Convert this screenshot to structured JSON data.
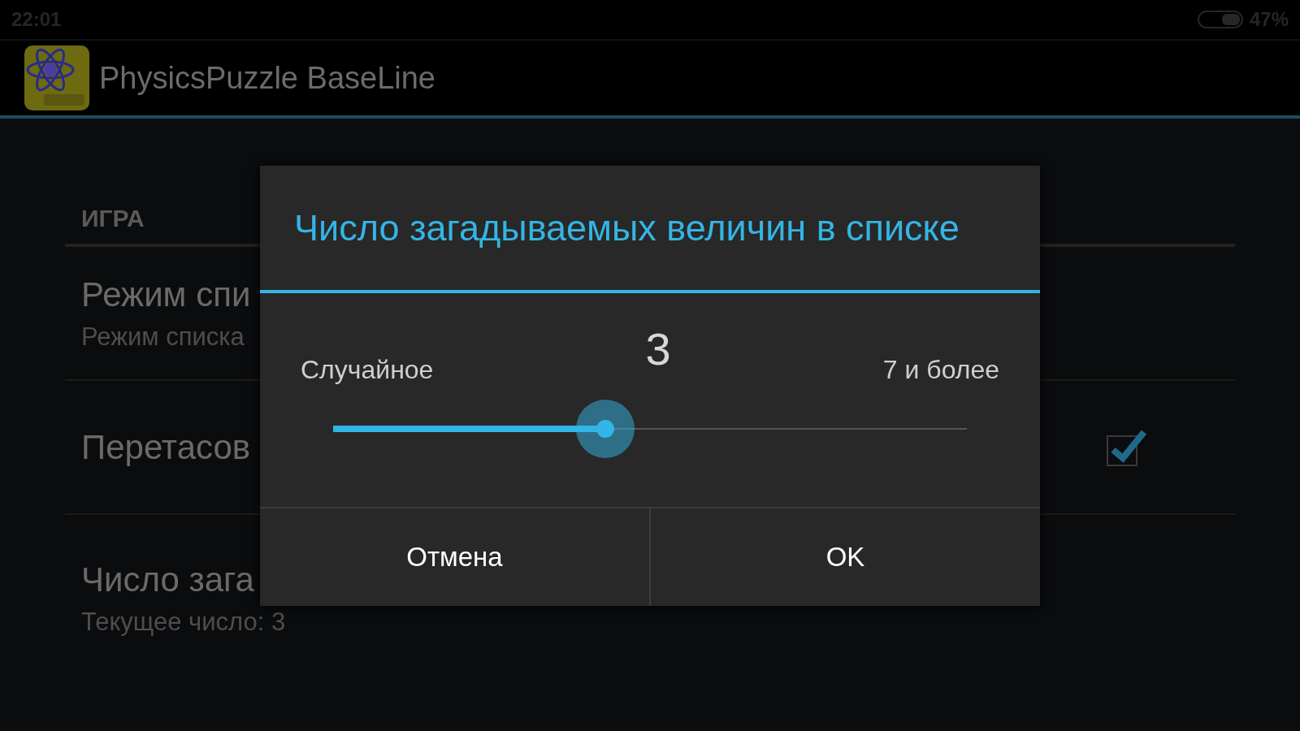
{
  "status_bar": {
    "time": "22:01",
    "battery": "47%"
  },
  "action_bar": {
    "title": "PhysicsPuzzle BaseLine"
  },
  "preferences": {
    "category": "ИГРА",
    "items": [
      {
        "kind": "text",
        "title": "Режим спи",
        "summary": "Режим списка"
      },
      {
        "kind": "checkbox",
        "title": "Перетасов",
        "checked": true
      },
      {
        "kind": "text",
        "title": "Число зага",
        "summary": "Текущее число: 3"
      }
    ]
  },
  "dialog": {
    "title": "Число загадываемых величин в списке",
    "min_label": "Случайное",
    "value": "3",
    "max_label": "7 и более",
    "slider": {
      "level": 0.43
    },
    "buttons": [
      "Отмена",
      "OK"
    ]
  }
}
